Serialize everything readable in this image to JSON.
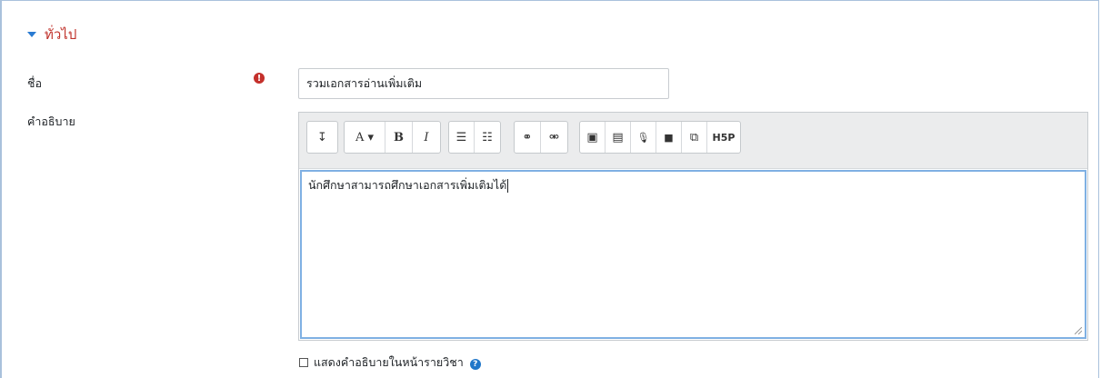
{
  "section": {
    "title": "ทั่วไป",
    "expanded": true
  },
  "fields": {
    "name": {
      "label": "ชื่อ",
      "value": "รวมเอกสารอ่านเพิ่มเติม",
      "required_icon": "exclamation-circle-icon"
    },
    "description": {
      "label": "คำอธิบาย",
      "content": "นักศึกษาสามารถศึกษาเอกสารเพิ่มเติมได้"
    }
  },
  "toolbar": {
    "groups": [
      [
        {
          "name": "toggle-toolbar-icon",
          "text": "↧"
        }
      ],
      [
        {
          "name": "font-size-icon",
          "text": "A ▾"
        },
        {
          "name": "bold-icon",
          "text": "B"
        },
        {
          "name": "italic-icon",
          "text": "I"
        }
      ],
      [
        {
          "name": "unordered-list-icon",
          "text": "☰"
        },
        {
          "name": "ordered-list-icon",
          "text": "☷"
        }
      ],
      [
        {
          "name": "link-icon",
          "text": "⚭"
        },
        {
          "name": "unlink-icon",
          "text": "⚮"
        }
      ],
      [
        {
          "name": "image-icon",
          "text": "▣"
        },
        {
          "name": "media-icon",
          "text": "▤"
        },
        {
          "name": "microphone-icon",
          "text": "🎙"
        },
        {
          "name": "video-icon",
          "text": "■"
        },
        {
          "name": "copy-icon",
          "text": "⧉"
        },
        {
          "name": "h5p-icon",
          "text": "H5P"
        }
      ]
    ]
  },
  "show_description": {
    "label": "แสดงคำอธิบายในหน้ารายวิชา",
    "checked": false,
    "help_icon": "question-circle-icon"
  },
  "colors": {
    "section_title": "#c0322b",
    "required": "#c4302b",
    "focus_border": "#7fb0e3",
    "help": "#1f76c9"
  }
}
